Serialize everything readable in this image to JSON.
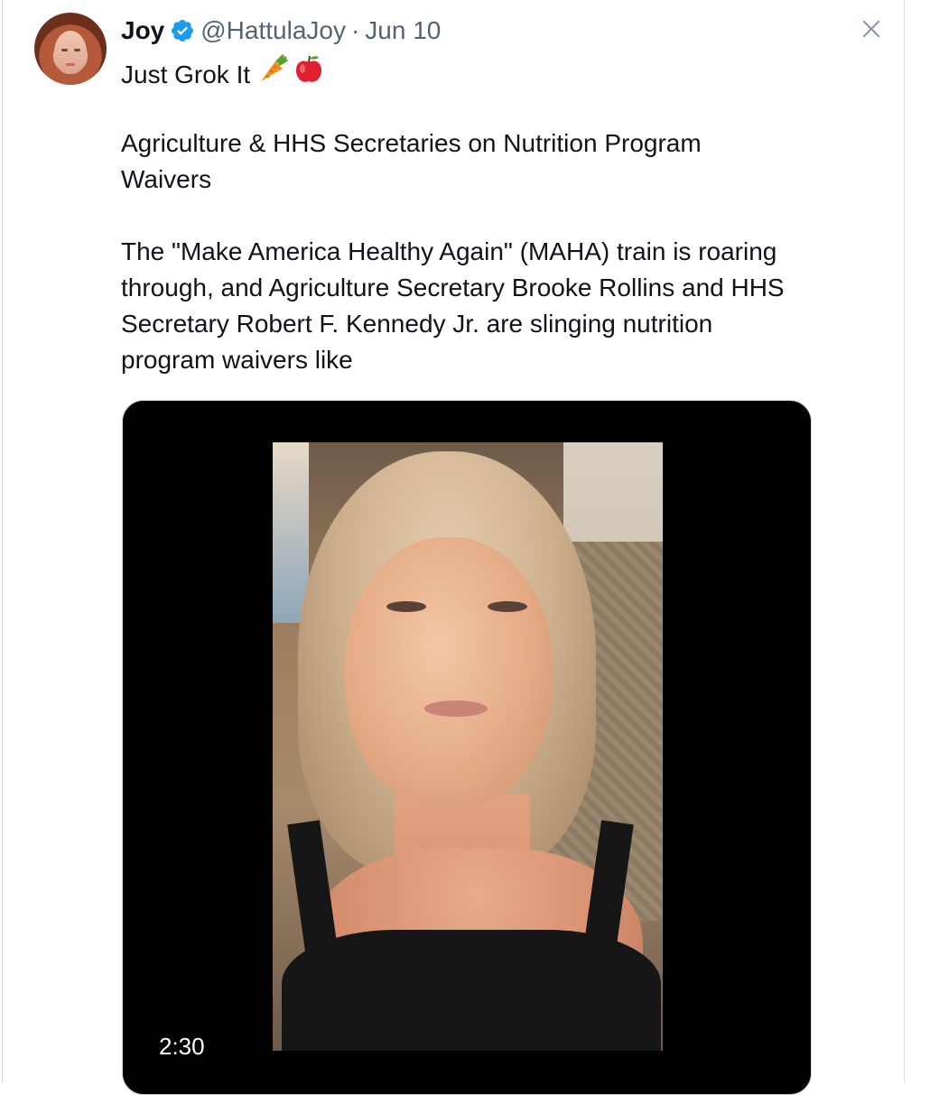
{
  "tweet": {
    "author_name": "Joy",
    "handle": "@HattulaJoy",
    "separator": "·",
    "date": "Jun 10",
    "line1": "Just Grok It",
    "emojis": [
      "carrot-emoji",
      "red-apple-emoji"
    ],
    "paragraph2": "Agriculture & HHS Secretaries on Nutrition Program Waivers",
    "paragraph3": "The \"Make America Healthy Again\" (MAHA) train is roaring through, and Agriculture Secretary Brooke Rollins and HHS Secretary Robert F. Kennedy Jr. are slinging nutrition program waivers like"
  },
  "media": {
    "duration": "2:30"
  },
  "icons": {
    "verified": "verified-badge-icon",
    "close": "close-icon"
  },
  "colors": {
    "verified_blue": "#1d9bf0",
    "text_primary": "#0f1419",
    "text_secondary": "#536471"
  }
}
